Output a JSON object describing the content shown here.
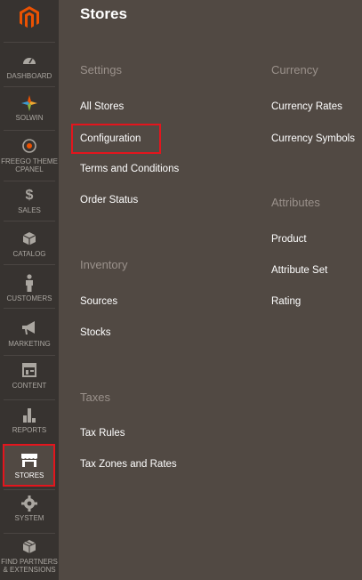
{
  "panel": {
    "title": "Stores",
    "settings": {
      "title": "Settings",
      "links": [
        "All Stores",
        "Configuration",
        "Terms and Conditions",
        "Order Status"
      ]
    },
    "inventory": {
      "title": "Inventory",
      "links": [
        "Sources",
        "Stocks"
      ]
    },
    "taxes": {
      "title": "Taxes",
      "links": [
        "Tax Rules",
        "Tax Zones and Rates"
      ]
    },
    "currency": {
      "title": "Currency",
      "links": [
        "Currency Rates",
        "Currency Symbols"
      ]
    },
    "attributes": {
      "title": "Attributes",
      "links": [
        "Product",
        "Attribute Set",
        "Rating"
      ]
    }
  },
  "sidebar": {
    "items": [
      {
        "label": "DASHBOARD",
        "icon": "dashboard-icon"
      },
      {
        "label": "SOLWIN",
        "icon": "solwin-icon"
      },
      {
        "label": "FREEGO THEME CPANEL",
        "icon": "target-icon"
      },
      {
        "label": "SALES",
        "icon": "dollar-icon"
      },
      {
        "label": "CATALOG",
        "icon": "box-icon"
      },
      {
        "label": "CUSTOMERS",
        "icon": "person-icon"
      },
      {
        "label": "MARKETING",
        "icon": "megaphone-icon"
      },
      {
        "label": "CONTENT",
        "icon": "layout-icon"
      },
      {
        "label": "REPORTS",
        "icon": "bar-chart-icon"
      },
      {
        "label": "STORES",
        "icon": "storefront-icon"
      },
      {
        "label": "SYSTEM",
        "icon": "gear-icon"
      },
      {
        "label": "FIND PARTNERS & EXTENSIONS",
        "icon": "cubes-icon"
      }
    ]
  },
  "colors": {
    "accent": "#eb5202",
    "highlight": "#e3151d",
    "panel_bg": "#514943",
    "sidebar_bg": "#373330"
  }
}
